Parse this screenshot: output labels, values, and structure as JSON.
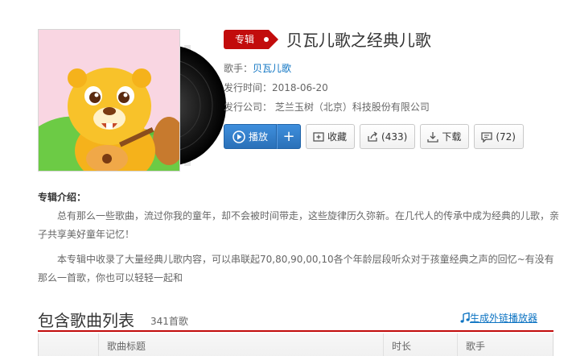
{
  "album": {
    "tag": "专辑",
    "title": "贝瓦儿歌之经典儿歌",
    "artist_label": "歌手：",
    "artist": "贝瓦儿歌",
    "release_label": "发行时间：",
    "release_date": "2018-06-20",
    "company_label": "发行公司：",
    "company": "芝兰玉树（北京）科技股份有限公司"
  },
  "actions": {
    "play": "播放",
    "add": "+",
    "collect": "收藏",
    "share_count": "(433)",
    "download": "下载",
    "comment_count": "(72)"
  },
  "intro": {
    "title": "专辑介绍：",
    "para1": "总有那么一些歌曲，流过你我的童年，却不会被时间带走，这些旋律历久弥新。在几代人的传承中成为经典的儿歌，亲子共享美好童年记忆！",
    "para2": "本专辑中收录了大量经典儿歌内容，可以串联起70,80,90,00,10各个年龄层段听众对于孩童经典之声的回忆~有没有那么一首歌，你也可以轻轻一起和"
  },
  "songlist": {
    "title": "包含歌曲列表",
    "count": "341首歌",
    "external_player": "生成外链播放器",
    "columns": [
      "",
      "歌曲标题",
      "时长",
      "歌手"
    ]
  },
  "colors": {
    "accent_red": "#c20c0c",
    "link_blue": "#0c73c2",
    "play_blue": "#2a70b8"
  }
}
